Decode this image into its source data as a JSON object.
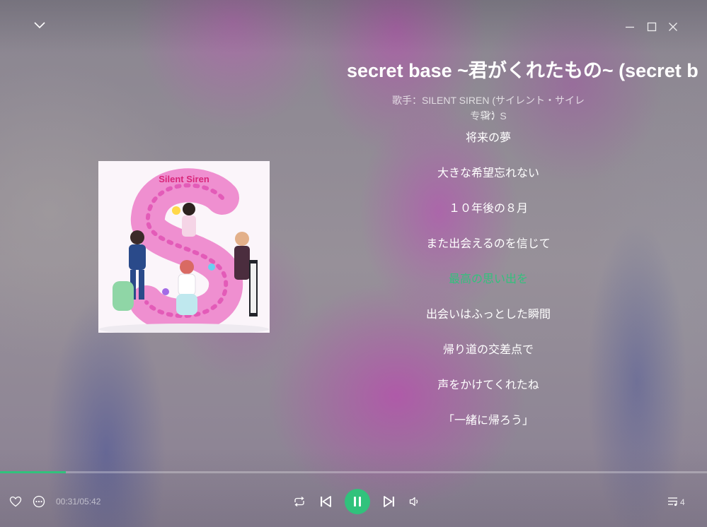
{
  "window": {
    "collapse_icon": "chevron-down-icon",
    "minimize_icon": "minimize-icon",
    "maximize_icon": "maximize-icon",
    "close_icon": "close-icon"
  },
  "song": {
    "title": "secret base ~君がくれたもの~ (secret b",
    "artist": "歌手：SILENT SIREN (サイレント・サイレン)",
    "album": "专辑：S"
  },
  "cover": {
    "brand_text": "Silent Siren",
    "letter": "S"
  },
  "lyrics": [
    {
      "text": "将来の夢",
      "active": false
    },
    {
      "text": "大きな希望忘れない",
      "active": false
    },
    {
      "text": "１０年後の８月",
      "active": false
    },
    {
      "text": "また出会えるのを信じて",
      "active": false
    },
    {
      "text": "最高の思い出を",
      "active": true
    },
    {
      "text": "出会いはふっとした瞬間",
      "active": false
    },
    {
      "text": "帰り道の交差点で",
      "active": false
    },
    {
      "text": "声をかけてくれたね",
      "active": false
    },
    {
      "text": "「一緒に帰ろう」",
      "active": false
    }
  ],
  "player": {
    "time": "00:31/05:42",
    "progress": 0.093,
    "queue_count": "4",
    "accent_color": "#31c27c",
    "icons": [
      "heart-icon",
      "more-icon",
      "repeat-icon",
      "previous-icon",
      "pause-icon",
      "next-icon",
      "volume-icon",
      "playlist-icon"
    ]
  }
}
